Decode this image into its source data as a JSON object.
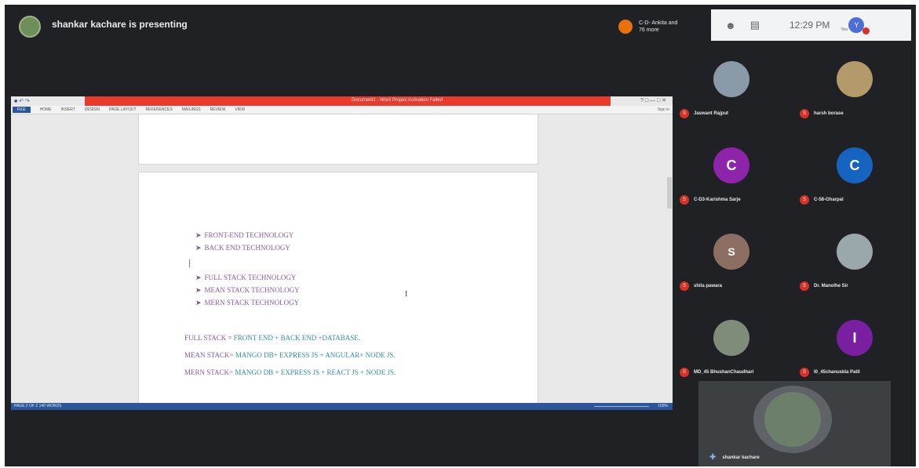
{
  "meeting": {
    "presenting_text": "shankar kachare is presenting",
    "others_label": "C-D- Ankita and 76 more",
    "time": "12:29 PM",
    "you_initial": "Y",
    "you_label": "You"
  },
  "word": {
    "title": "Document1 - Word Project Activation Failed",
    "tabs": [
      "FILE",
      "HOME",
      "INSERT",
      "DESIGN",
      "PAGE LAYOUT",
      "REFERENCES",
      "MAILINGS",
      "REVIEW",
      "VIEW"
    ],
    "signin": "Sign in",
    "bullets_group1": [
      "FRONT-END TECHNOLOGY",
      "BACK END TECHNOLOGY"
    ],
    "bullets_group2": [
      "FULL STACK TECHNOLOGY",
      "MEAN STACK TECHNOLOGY",
      "MERN STACK TECHNOLOGY"
    ],
    "formulas": [
      {
        "lhs": "FULL STACK = ",
        "rhs": "FRONT END + BACK END +DATABASE."
      },
      {
        "lhs": "MEAN STACK= ",
        "rhs": "MANGO DB+ EXPRESS JS + ANGULAR+ NODE JS."
      },
      {
        "lhs": "MERN STACK= ",
        "rhs": "MANGO DB + EXPRESS JS + REACT JS + NODE JS."
      }
    ],
    "status_left": "PAGE 2 OF 2    140 WORDS",
    "status_right": "100%"
  },
  "participants": [
    {
      "name": "Jaswant Rajput",
      "initial": "",
      "color": "#8a9aa8",
      "photo": true
    },
    {
      "name": "harsh borase",
      "initial": "",
      "color": "#b39a6a",
      "photo": true
    },
    {
      "name": "C-D3-Karishma Sarje",
      "initial": "C",
      "color": "#8e24aa",
      "photo": false
    },
    {
      "name": "C-58-Gharpal",
      "initial": "C",
      "color": "#1565c0",
      "photo": false
    },
    {
      "name": "shila pawara",
      "initial": "S",
      "color": "#8d6e63",
      "photo": false
    },
    {
      "name": "Dr. Manolhe Sir",
      "initial": "",
      "color": "#9aa7ab",
      "photo": true
    },
    {
      "name": "MD_45 BhushanChaudhari",
      "initial": "",
      "color": "#7f8c7a",
      "photo": true
    },
    {
      "name": "I0_45chanuskla Patil",
      "initial": "I",
      "color": "#7b1fa2",
      "photo": false
    }
  ],
  "self": {
    "name": "shankar kachare"
  },
  "colors": {
    "background": "#202124",
    "accent_red": "#d93025",
    "word_blue": "#2b579a"
  }
}
